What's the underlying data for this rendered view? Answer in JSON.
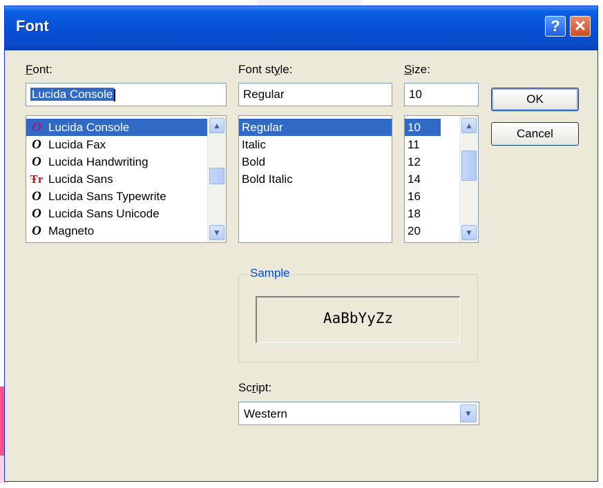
{
  "dialog": {
    "title": "Font"
  },
  "titlebar": {
    "help_label": "?",
    "close_label": "✕"
  },
  "font_section": {
    "label_mnemonic": "F",
    "label_rest": "ont:",
    "input_value": "Lucida Console",
    "items": [
      {
        "label": "Lucida Console",
        "icon": "opentype-font-icon",
        "glyph": "O"
      },
      {
        "label": "Lucida Fax",
        "icon": "opentype-font-icon",
        "glyph": "O"
      },
      {
        "label": "Lucida Handwriting",
        "icon": "opentype-font-icon",
        "glyph": "O"
      },
      {
        "label": "Lucida Sans",
        "icon": "truetype-font-icon",
        "glyph": "Ŧr"
      },
      {
        "label": "Lucida Sans Typewrite",
        "icon": "opentype-font-icon",
        "glyph": "O"
      },
      {
        "label": "Lucida Sans Unicode",
        "icon": "opentype-font-icon",
        "glyph": "O"
      },
      {
        "label": "Magneto",
        "icon": "opentype-font-icon",
        "glyph": "O"
      }
    ]
  },
  "style_section": {
    "label_before": "Font st",
    "label_mnemonic": "y",
    "label_after": "le:",
    "input_value": "Regular",
    "items": [
      "Regular",
      "Italic",
      "Bold",
      "Bold Italic"
    ]
  },
  "size_section": {
    "label_mnemonic": "S",
    "label_rest": "ize:",
    "input_value": "10",
    "items": [
      "10",
      "11",
      "12",
      "14",
      "16",
      "18",
      "20"
    ]
  },
  "buttons": {
    "ok": "OK",
    "cancel": "Cancel"
  },
  "sample": {
    "label": "Sample",
    "text": "AaBbYyZz"
  },
  "script_section": {
    "label_before": "Sc",
    "label_mnemonic": "r",
    "label_after": "ipt:",
    "value": "Western"
  },
  "icons": {
    "scroll_up": "▲",
    "scroll_down": "▼",
    "dropdown": "▼"
  },
  "colors": {
    "titlebar": "#0a5ee2",
    "selection": "#316ac5",
    "dialog_bg": "#ece9d8",
    "group_label": "#0046d5"
  }
}
